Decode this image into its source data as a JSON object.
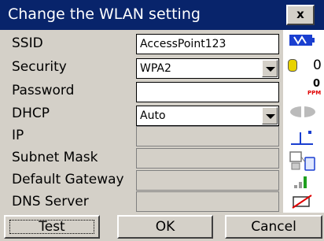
{
  "window": {
    "title": "Change the WLAN setting",
    "close_label": "x"
  },
  "form": {
    "ssid": {
      "label": "SSID",
      "value": "AccessPoint123"
    },
    "security": {
      "label": "Security",
      "value": "WPA2"
    },
    "password": {
      "label": "Password",
      "value": ""
    },
    "dhcp": {
      "label": "DHCP",
      "value": "Auto"
    },
    "ip": {
      "label": "IP",
      "value": ""
    },
    "subnet_mask": {
      "label": "Subnet Mask",
      "value": ""
    },
    "default_gateway": {
      "label": "Default Gateway",
      "value": ""
    },
    "dns_server": {
      "label": "DNS Server",
      "value": ""
    }
  },
  "status": {
    "battery_icon": "battery-icon",
    "gas_count": "0",
    "ppm_value": "0",
    "ppm_unit": "PPM"
  },
  "buttons": {
    "test": "Test",
    "ok": "OK",
    "cancel": "Cancel"
  },
  "colors": {
    "titlebar": "#08246b",
    "panel": "#d4d0c8",
    "accent_blue": "#1a3fd0",
    "alert_red": "#e00000"
  }
}
